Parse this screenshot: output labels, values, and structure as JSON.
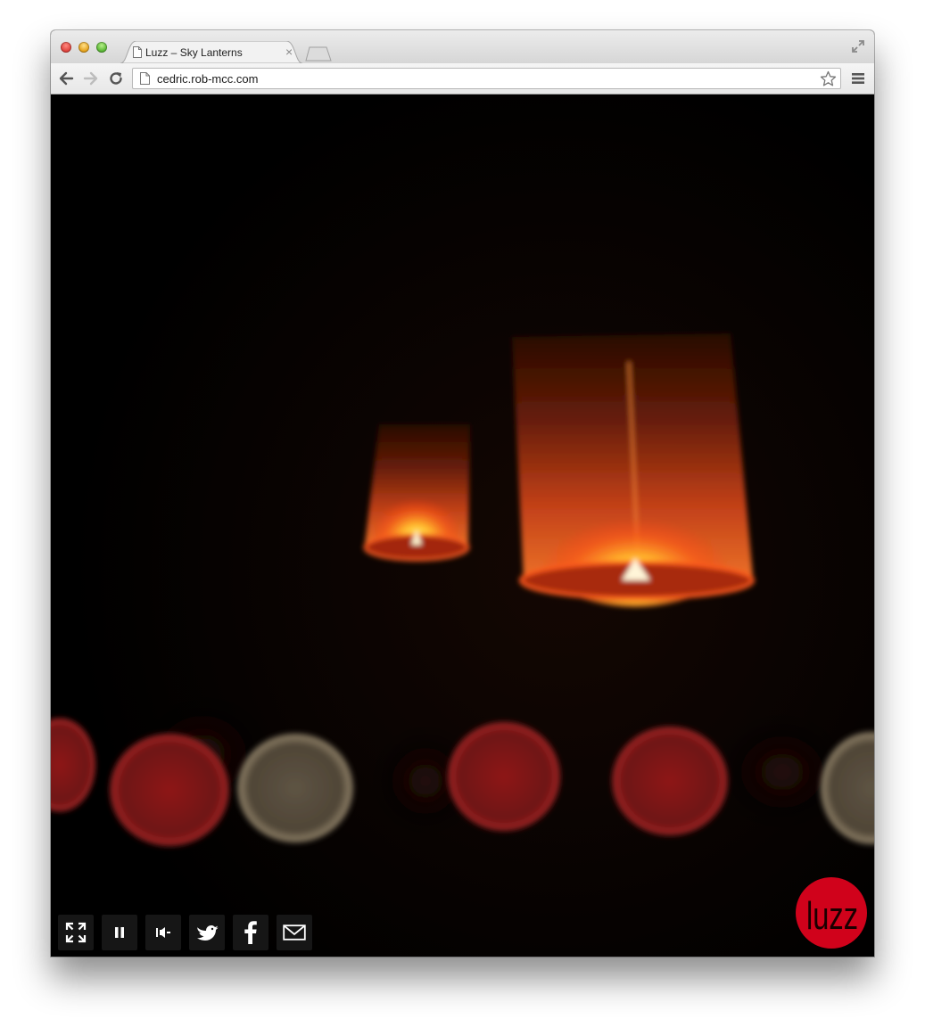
{
  "browser": {
    "tab": {
      "title": "Luzz – Sky Lanterns",
      "close_glyph": "×"
    },
    "omnibox": {
      "url": "cedric.rob-mcc.com"
    },
    "icons": {
      "back": "back-arrow-icon",
      "forward": "forward-arrow-icon",
      "reload": "reload-icon",
      "bookmark": "star-icon",
      "menu": "hamburger-menu-icon",
      "fullscreen": "expand-window-icon"
    }
  },
  "player": {
    "controls": [
      {
        "id": "fullscreen",
        "icon": "fullscreen-icon"
      },
      {
        "id": "pause",
        "icon": "pause-icon"
      },
      {
        "id": "volume",
        "icon": "volume-icon"
      },
      {
        "id": "twitter",
        "icon": "twitter-bird-icon"
      },
      {
        "id": "facebook",
        "icon": "facebook-icon"
      },
      {
        "id": "email",
        "icon": "email-envelope-icon"
      }
    ],
    "logo": {
      "text": "luzz",
      "color": "#d0021b"
    }
  },
  "colors": {
    "accent": "#d0021b",
    "control_bg": "#161616",
    "control_icon": "#ffffff"
  }
}
